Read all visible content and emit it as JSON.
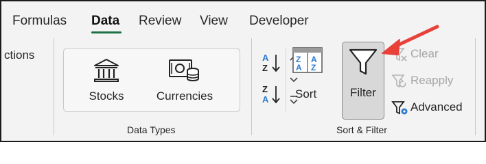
{
  "tabs": [
    {
      "label": "Formulas",
      "active": false
    },
    {
      "label": "Data",
      "active": true
    },
    {
      "label": "Review",
      "active": false
    },
    {
      "label": "View",
      "active": false
    },
    {
      "label": "Developer",
      "active": false
    }
  ],
  "ribbon": {
    "cut_label": "ctions",
    "data_types": {
      "stocks_label": "Stocks",
      "currencies_label": "Currencies",
      "group_label": "Data Types"
    },
    "sort_filter": {
      "sort_az_icon": "sort-ascending-icon",
      "sort_za_icon": "sort-descending-icon",
      "sort_label": "Sort",
      "filter_label": "Filter",
      "clear_label": "Clear",
      "reapply_label": "Reapply",
      "advanced_label": "Advanced",
      "group_label": "Sort & Filter"
    }
  },
  "annotation": {
    "icon": "red-arrow-icon",
    "color": "#e8413a"
  },
  "colors": {
    "active_tab_underline": "#1e7145",
    "sort_blue": "#2b7bd0",
    "disabled_text": "#a6a6a6"
  }
}
